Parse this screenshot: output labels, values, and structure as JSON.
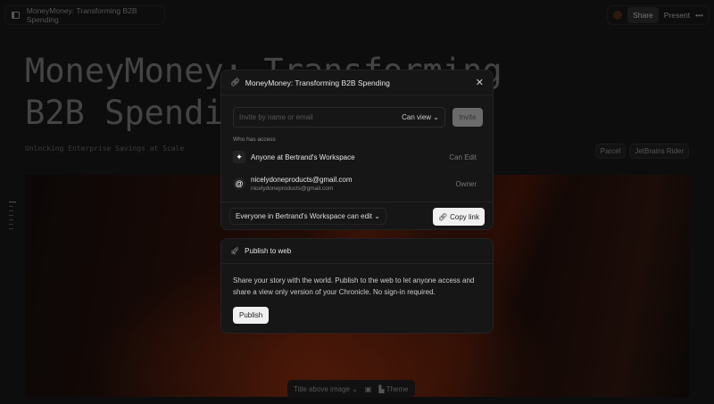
{
  "topbar": {
    "doc_title": "MoneyMoney: Transforming B2B Spending",
    "share": "Share",
    "present": "Present",
    "more": "•••"
  },
  "page": {
    "title": "MoneyMoney: Transforming B2B Spending",
    "subtitle": "Unlocking Enterprise Savings at Scale",
    "tags": [
      "Parcel",
      "JetBrains Rider"
    ]
  },
  "share_modal": {
    "title": "MoneyMoney: Transforming B2B Spending",
    "invite_placeholder": "Invite by name or email",
    "permission": "Can view",
    "invite_button": "Invite",
    "who_label": "Who has access",
    "access": [
      {
        "name": "Anyone at Bertrand's Workspace",
        "role": "Can Edit"
      },
      {
        "name": "nicelydoneproducts@gmail.com",
        "email": "nicelydoneproducts@gmail.com",
        "role": "Owner"
      }
    ],
    "general_access": "Everyone in Bertrand's Workspace can edit",
    "copy_link": "Copy link"
  },
  "publish": {
    "title": "Publish to web",
    "description": "Share your story with the world. Publish to the web to let anyone access and share a view only version of your Chronicle. No sign-in required.",
    "button": "Publish"
  },
  "bottombar": {
    "layout": "Title above image",
    "theme": "Theme"
  }
}
